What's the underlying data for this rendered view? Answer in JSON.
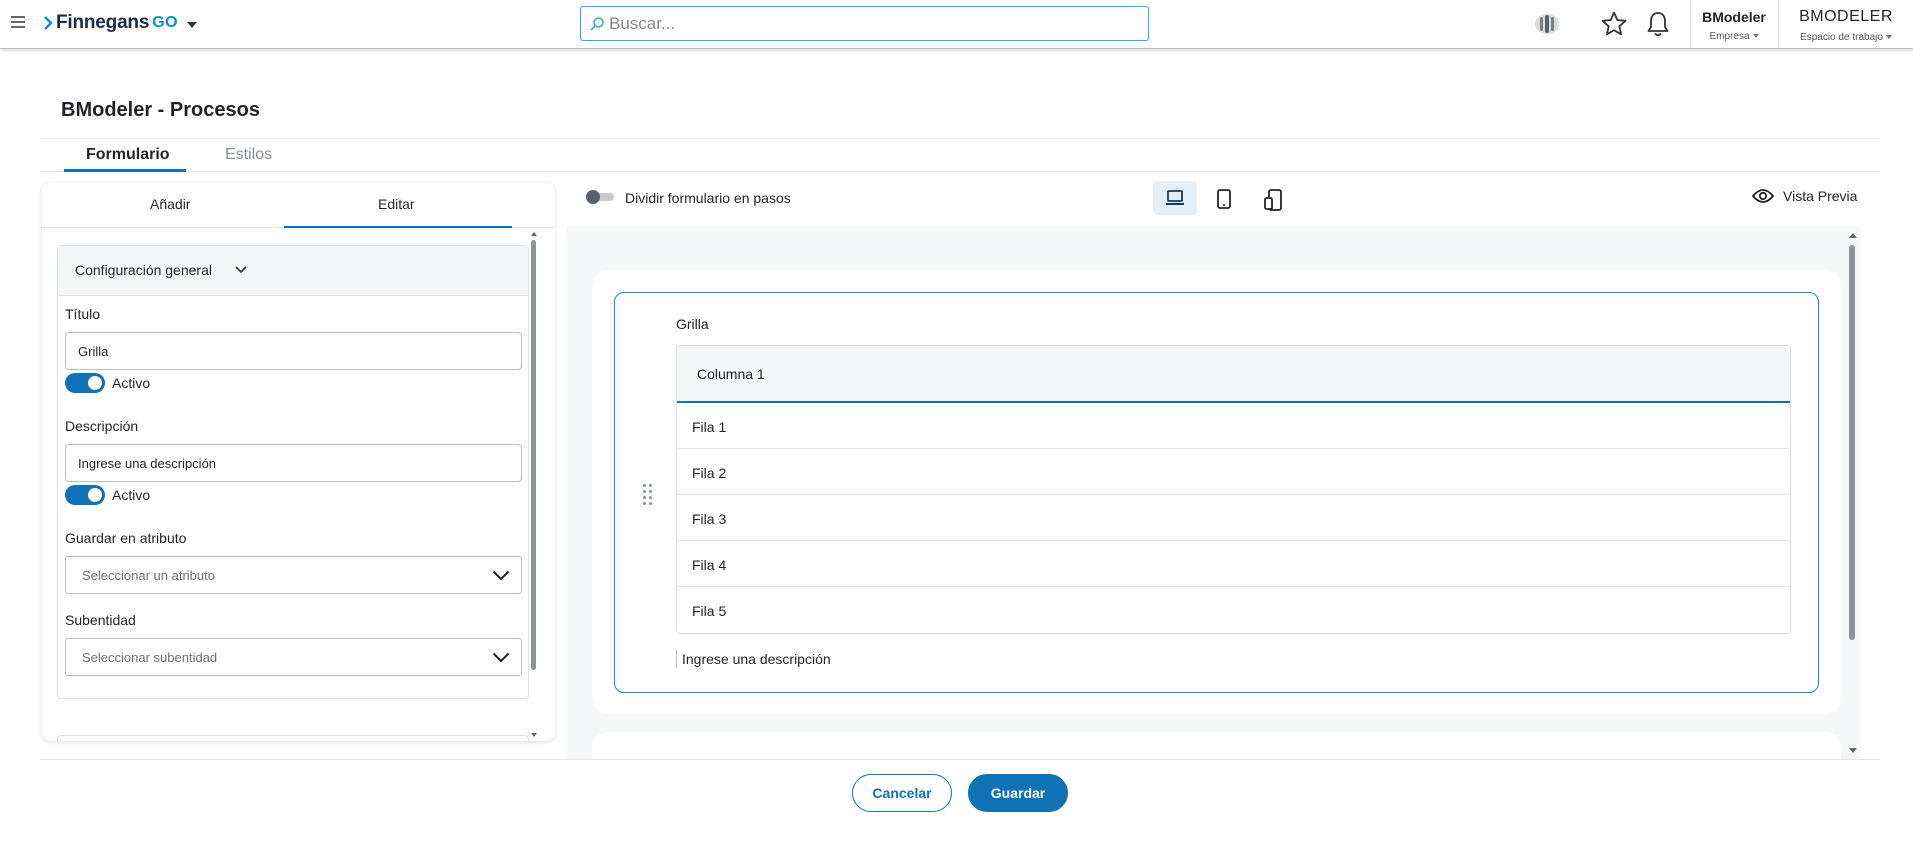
{
  "topbar": {
    "logo_main": "Finnegans",
    "logo_go": "GO",
    "search_placeholder": "Buscar...",
    "company_name": "BModeler",
    "company_sub": "Empresa",
    "workspace_name": "BMODELER",
    "workspace_sub": "Espacio de trabajo"
  },
  "page": {
    "title": "BModeler - Procesos",
    "tabs": [
      {
        "label": "Formulario",
        "active": true
      },
      {
        "label": "Estilos",
        "active": false
      }
    ]
  },
  "left_panel": {
    "tabs": [
      {
        "label": "Añadir"
      },
      {
        "label": "Editar",
        "active": true
      }
    ],
    "section_title": "Configuración general",
    "fields": {
      "title_label": "Título",
      "title_value": "Grilla",
      "title_toggle_label": "Activo",
      "description_label": "Descripción",
      "description_value": "Ingrese una descripción",
      "description_toggle_label": "Activo",
      "attribute_label": "Guardar en atributo",
      "attribute_placeholder": "Seleccionar un atributo",
      "subentity_label": "Subentidad",
      "subentity_placeholder": "Seleccionar subentidad"
    }
  },
  "toolbar": {
    "split_label": "Dividir formulario en pasos",
    "preview_label": "Vista Previa"
  },
  "grid": {
    "title": "Grilla",
    "columns": [
      "Columna 1"
    ],
    "rows": [
      "Fila 1",
      "Fila 2",
      "Fila 3",
      "Fila 4",
      "Fila 5"
    ],
    "description": "Ingrese una descripción"
  },
  "actions": {
    "cancel": "Cancelar",
    "save": "Guardar"
  },
  "colors": {
    "accent": "#1072b6",
    "search_border": "#27b3c9",
    "frame_border": "#1a8bd0"
  }
}
